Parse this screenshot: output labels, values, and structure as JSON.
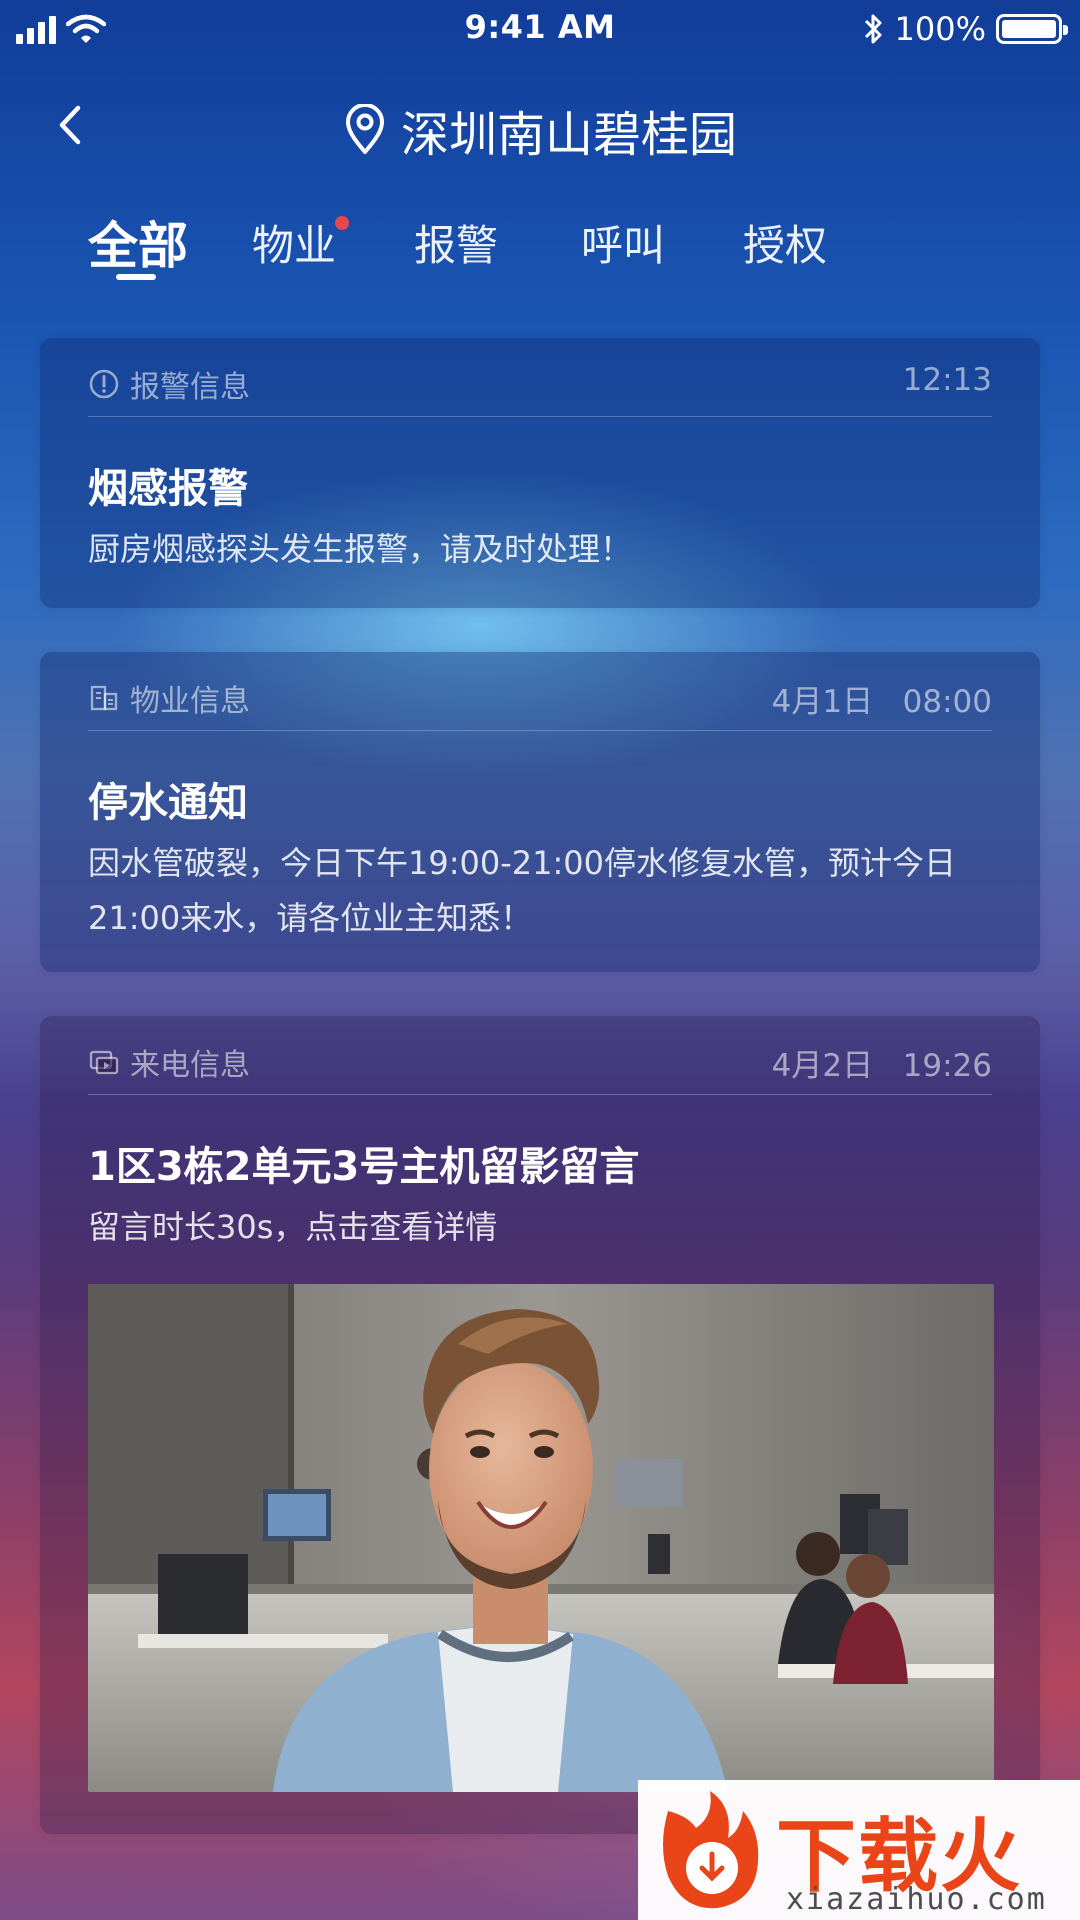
{
  "status_bar": {
    "time": "9:41 AM",
    "battery": "100%",
    "icons": [
      "signal-icon",
      "wifi-icon",
      "bluetooth-icon",
      "battery-icon"
    ]
  },
  "nav": {
    "title": "深圳南山碧桂园",
    "back_icon": "chevron-left-icon",
    "location_icon": "location-pin-icon"
  },
  "tabs": [
    {
      "label": "全部",
      "active": true
    },
    {
      "label": "物业",
      "active": false,
      "badge": true
    },
    {
      "label": "报警",
      "active": false
    },
    {
      "label": "呼叫",
      "active": false
    },
    {
      "label": "授权",
      "active": false
    }
  ],
  "cards": [
    {
      "type_label": "报警信息",
      "type_icon": "alert-circle-icon",
      "time": "12:13",
      "title": "烟感报警",
      "body": "厨房烟感探头发生报警，请及时处理！"
    },
    {
      "type_label": "物业信息",
      "type_icon": "building-icon",
      "time": "4月1日   08:00",
      "title": "停水通知",
      "body": "因水管破裂，今日下午19:00-21:00停水修复水管，预计今日21:00来水，请各位业主知悉！"
    },
    {
      "type_label": "来电信息",
      "type_icon": "video-call-icon",
      "time": "4月2日   19:26",
      "title": "1区3栋2单元3号主机留影留言",
      "body": "留言时长30s，点击查看详情",
      "image": "video-snapshot-smiling-man-office"
    }
  ],
  "watermark": {
    "main": "下载火",
    "sub": "xiazaihuo.com"
  },
  "colors": {
    "tab_badge": "#e5484d",
    "watermark_orange": "#ea4518"
  }
}
